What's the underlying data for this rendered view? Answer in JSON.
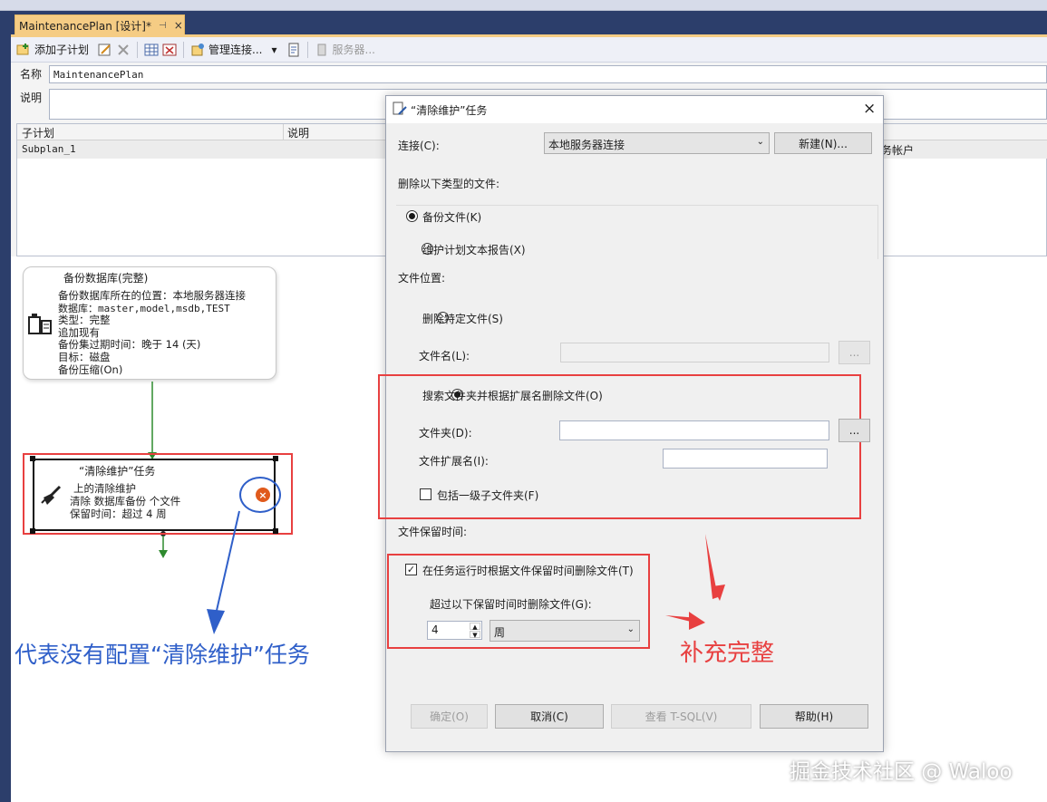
{
  "document_tab": {
    "title": "MaintenancePlan [设计]*",
    "pin": "⊣",
    "close": "×"
  },
  "toolbar": {
    "add_subplan": "添加子计划",
    "manage_connections": "管理连接...",
    "servers": "服务器..."
  },
  "plan": {
    "name_label": "名称",
    "name_value": "MaintenancePlan",
    "desc_label": "说明",
    "grid_headers": [
      "子计划",
      "说明"
    ],
    "grid_header_right": "务帐户",
    "subplan_row": "Subplan_1"
  },
  "backup_task": {
    "title": "备份数据库(完整)",
    "lines": [
      "备份数据库所在的位置：本地服务器连接",
      "数据库：master,model,msdb,TEST",
      "类型：完整",
      "追加现有",
      "备份集过期时间：晚于 14 (天)",
      "目标：磁盘",
      "备份压缩(On)"
    ]
  },
  "cleanup_task": {
    "title": "“清除维护”任务",
    "lines": [
      "上的清除维护",
      "清除 数据库备份 个文件",
      "保留时间：超过 4 周"
    ]
  },
  "annotations": {
    "left_text": "代表没有配置“清除维护”任务",
    "right_text": "补充完整",
    "watermark": "掘金技术社区 @ Waloo",
    "blue": "#2f5fc9",
    "red": "#e84040"
  },
  "dialog": {
    "title": "“清除维护”任务",
    "close": "×",
    "connection_label": "连接(C):",
    "connection_value": "本地服务器连接",
    "new_button": "新建(N)...",
    "delete_types_label": "删除以下类型的文件:",
    "backup_files": "备份文件(K)",
    "report_files": "维护计划文本报告(X)",
    "file_location_label": "文件位置:",
    "delete_specific": "删除特定文件(S)",
    "filename_label": "文件名(L):",
    "search_folder": "搜索文件夹并根据扩展名删除文件(O)",
    "folder_label": "文件夹(D):",
    "extension_label": "文件扩展名(I):",
    "include_subfolders": "包括一级子文件夹(F)",
    "browse": "...",
    "retention_label": "文件保留时间:",
    "delete_by_age": "在任务运行时根据文件保留时间删除文件(T)",
    "older_than_label": "超过以下保留时间时删除文件(G):",
    "age_value": "4",
    "age_unit": "周",
    "ok": "确定(O)",
    "cancel": "取消(C)",
    "view_tsql": "查看 T-SQL(V)",
    "help": "帮助(H)"
  }
}
